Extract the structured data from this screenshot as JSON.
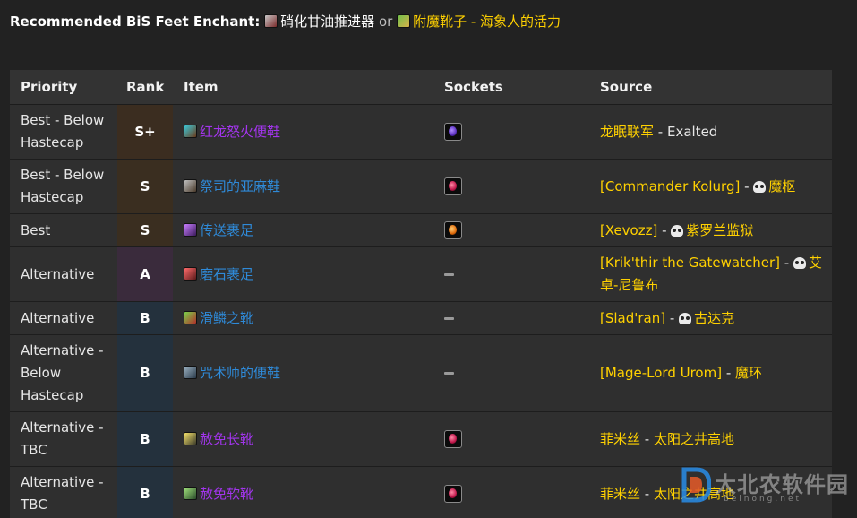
{
  "enchant": {
    "label": "Recommended BiS Feet Enchant",
    "colon": ":",
    "option1": "硝化甘油推进器",
    "or_text": "or",
    "option2": "附魔靴子 - 海象人的活力"
  },
  "table": {
    "headers": {
      "priority": "Priority",
      "rank": "Rank",
      "item": "Item",
      "sockets": "Sockets",
      "source": "Source"
    },
    "rows": [
      {
        "priority": "Best - Below Hastecap",
        "rank": "S+",
        "item": "红龙怒火便鞋",
        "item_color": "#a335ee",
        "socket": "purple-gem-icon",
        "source_parts": [
          "龙眠联军",
          " - ",
          "Exalted"
        ],
        "source_skull": false
      },
      {
        "priority": "Best - Below Hastecap",
        "rank": "S",
        "item": "祭司的亚麻鞋",
        "item_color": "#2f8ad8",
        "socket": "red-gem-icon",
        "source_parts": [
          "[Commander Kolurg]",
          " - ",
          "魔枢"
        ],
        "source_skull": true
      },
      {
        "priority": "Best",
        "rank": "S",
        "item": "传送裹足",
        "item_color": "#2f8ad8",
        "socket": "orange-gem-icon",
        "source_parts": [
          "[Xevozz]",
          " - ",
          "紫罗兰监狱"
        ],
        "source_skull": true
      },
      {
        "priority": "Alternative",
        "rank": "A",
        "item": "磨石裹足",
        "item_color": "#2f8ad8",
        "socket": "dash",
        "source_parts": [
          "[Krik'thir the Gatewatcher]",
          " - ",
          "艾卓-尼鲁布"
        ],
        "source_skull": true
      },
      {
        "priority": "Alternative",
        "rank": "B",
        "item": "滑鳞之靴",
        "item_color": "#2f8ad8",
        "socket": "dash",
        "source_parts": [
          "[Slad'ran]",
          " - ",
          "古达克"
        ],
        "source_skull": true
      },
      {
        "priority": "Alternative - Below Hastecap",
        "rank": "B",
        "item": "咒术师的便鞋",
        "item_color": "#2f8ad8",
        "socket": "dash",
        "source_parts": [
          "[Mage-Lord Urom]",
          " - ",
          "魔环"
        ],
        "source_skull": false
      },
      {
        "priority": "Alternative - TBC",
        "rank": "B",
        "item": "赦免长靴",
        "item_color": "#a335ee",
        "socket": "red-gem-icon",
        "source_parts": [
          "菲米丝",
          " - ",
          "太阳之井高地"
        ],
        "source_skull": false
      },
      {
        "priority": "Alternative - TBC",
        "rank": "B",
        "item": "赦免软靴",
        "item_color": "#a335ee",
        "socket": "red-gem-icon",
        "source_parts": [
          "菲米丝",
          " - ",
          "太阳之井高地"
        ],
        "source_skull": false
      }
    ]
  },
  "watermark": {
    "text": "大北农软件园",
    "url": "beinong.net"
  },
  "colors": {
    "gold": "#ffd100",
    "epic": "#a335ee",
    "rare": "#2f8ad8",
    "background": "#222222"
  }
}
